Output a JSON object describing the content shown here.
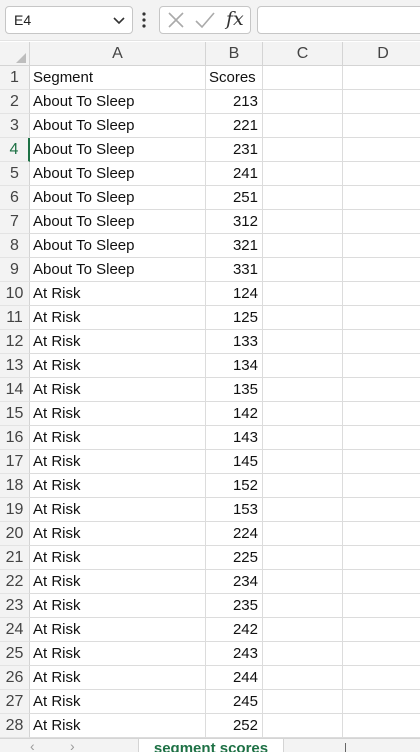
{
  "formula_bar": {
    "name_box": "E4",
    "cancel_icon": "x-icon",
    "enter_icon": "check-icon",
    "fx_label": "fx",
    "formula_value": ""
  },
  "columns": [
    "A",
    "B",
    "C",
    "D"
  ],
  "active_cell": "E4",
  "rows": [
    {
      "n": "1",
      "a": "Segment",
      "b": "Scores"
    },
    {
      "n": "2",
      "a": "About To Sleep",
      "b": "213"
    },
    {
      "n": "3",
      "a": "About To Sleep",
      "b": "221"
    },
    {
      "n": "4",
      "a": "About To Sleep",
      "b": "231"
    },
    {
      "n": "5",
      "a": "About To Sleep",
      "b": "241"
    },
    {
      "n": "6",
      "a": "About To Sleep",
      "b": "251"
    },
    {
      "n": "7",
      "a": "About To Sleep",
      "b": "312"
    },
    {
      "n": "8",
      "a": "About To Sleep",
      "b": "321"
    },
    {
      "n": "9",
      "a": "About To Sleep",
      "b": "331"
    },
    {
      "n": "10",
      "a": "At Risk",
      "b": "124"
    },
    {
      "n": "11",
      "a": "At Risk",
      "b": "125"
    },
    {
      "n": "12",
      "a": "At Risk",
      "b": "133"
    },
    {
      "n": "13",
      "a": "At Risk",
      "b": "134"
    },
    {
      "n": "14",
      "a": "At Risk",
      "b": "135"
    },
    {
      "n": "15",
      "a": "At Risk",
      "b": "142"
    },
    {
      "n": "16",
      "a": "At Risk",
      "b": "143"
    },
    {
      "n": "17",
      "a": "At Risk",
      "b": "145"
    },
    {
      "n": "18",
      "a": "At Risk",
      "b": "152"
    },
    {
      "n": "19",
      "a": "At Risk",
      "b": "153"
    },
    {
      "n": "20",
      "a": "At Risk",
      "b": "224"
    },
    {
      "n": "21",
      "a": "At Risk",
      "b": "225"
    },
    {
      "n": "22",
      "a": "At Risk",
      "b": "234"
    },
    {
      "n": "23",
      "a": "At Risk",
      "b": "235"
    },
    {
      "n": "24",
      "a": "At Risk",
      "b": "242"
    },
    {
      "n": "25",
      "a": "At Risk",
      "b": "243"
    },
    {
      "n": "26",
      "a": "At Risk",
      "b": "244"
    },
    {
      "n": "27",
      "a": "At Risk",
      "b": "245"
    },
    {
      "n": "28",
      "a": "At Risk",
      "b": "252"
    }
  ],
  "sheet_tabs": {
    "prev_icon": "chevron-left-icon",
    "next_icon": "chevron-right-icon",
    "active": "segment scores"
  },
  "colors": {
    "accent": "#1e7145",
    "header_bg": "#f3f3f3",
    "gridline": "#dcdcdc"
  }
}
